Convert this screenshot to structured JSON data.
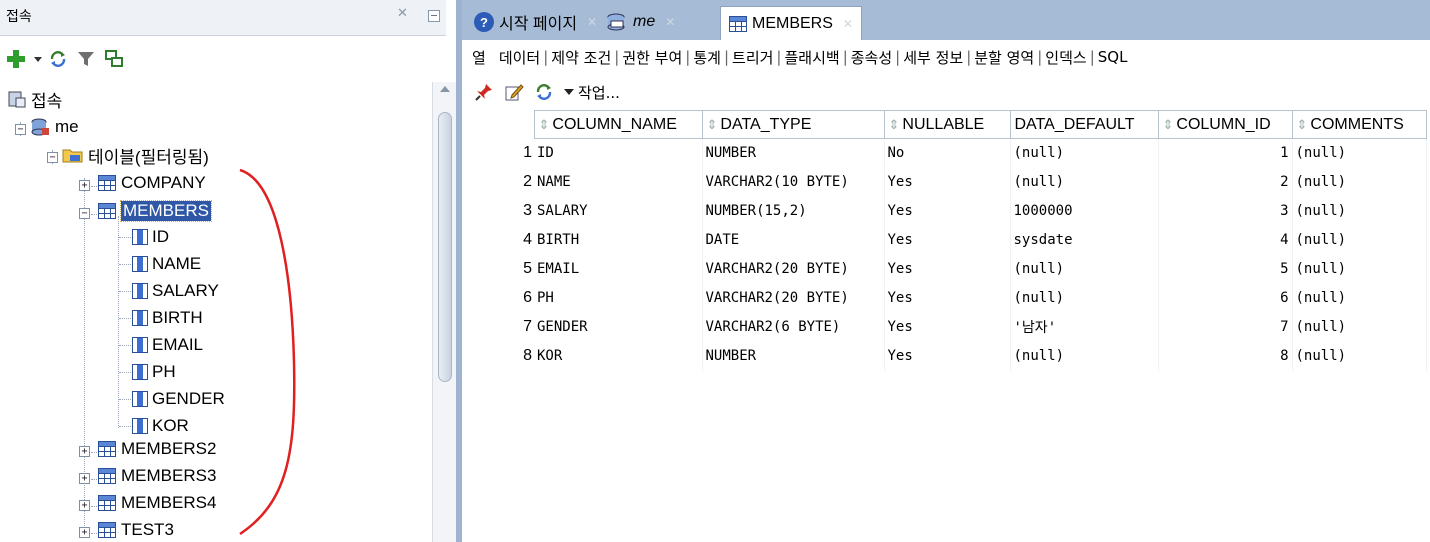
{
  "connections_panel": {
    "title": "접속",
    "root_label": "접속",
    "connection_name": "me",
    "tables_folder_label": "테이블(필터링됨)",
    "tables": [
      "COMPANY",
      "MEMBERS",
      "MEMBERS2",
      "MEMBERS3",
      "MEMBERS4",
      "TEST3"
    ],
    "selected_table": "MEMBERS",
    "members_columns": [
      "ID",
      "NAME",
      "SALARY",
      "BIRTH",
      "EMAIL",
      "PH",
      "GENDER",
      "KOR"
    ],
    "toolbar_icons": [
      "add-icon",
      "dropdown-icon",
      "refresh-icon",
      "filter-icon",
      "schema-browser-icon"
    ]
  },
  "editor": {
    "tabs": [
      {
        "label": "시작 페이지",
        "icon": "help-icon"
      },
      {
        "label": "me",
        "icon": "sql-connection-icon"
      },
      {
        "label": "MEMBERS",
        "icon": "table-icon"
      }
    ],
    "active_tab": "MEMBERS",
    "subtabs": [
      "열",
      "데이터",
      "제약 조건",
      "권한 부여",
      "통계",
      "트리거",
      "플래시백",
      "종속성",
      "세부 정보",
      "분할 영역",
      "인덱스",
      "SQL"
    ],
    "active_subtab": "열",
    "toolbar": {
      "action_label": "작업..."
    },
    "grid": {
      "headers": [
        "COLUMN_NAME",
        "DATA_TYPE",
        "NULLABLE",
        "DATA_DEFAULT",
        "COLUMN_ID",
        "COMMENTS"
      ],
      "rows": [
        {
          "n": "1",
          "name": "ID",
          "type": "NUMBER",
          "nullable": "No",
          "default": "(null)",
          "id": "1",
          "comments": "(null)"
        },
        {
          "n": "2",
          "name": "NAME",
          "type": "VARCHAR2(10 BYTE)",
          "nullable": "Yes",
          "default": "(null)",
          "id": "2",
          "comments": "(null)"
        },
        {
          "n": "3",
          "name": "SALARY",
          "type": "NUMBER(15,2)",
          "nullable": "Yes",
          "default": "1000000",
          "id": "3",
          "comments": "(null)"
        },
        {
          "n": "4",
          "name": "BIRTH",
          "type": "DATE",
          "nullable": "Yes",
          "default": "sysdate",
          "id": "4",
          "comments": "(null)"
        },
        {
          "n": "5",
          "name": "EMAIL",
          "type": "VARCHAR2(20 BYTE)",
          "nullable": "Yes",
          "default": "(null)",
          "id": "5",
          "comments": "(null)"
        },
        {
          "n": "6",
          "name": "PH",
          "type": "VARCHAR2(20 BYTE)",
          "nullable": "Yes",
          "default": "(null)",
          "id": "6",
          "comments": "(null)"
        },
        {
          "n": "7",
          "name": "GENDER",
          "type": "VARCHAR2(6 BYTE)",
          "nullable": "Yes",
          "default": "'남자'",
          "id": "7",
          "comments": "(null)"
        },
        {
          "n": "8",
          "name": "KOR",
          "type": "NUMBER",
          "nullable": "Yes",
          "default": "(null)",
          "id": "8",
          "comments": "(null)"
        }
      ]
    }
  },
  "colors": {
    "selection": "#2f57a6",
    "tab_bar": "#a6bbd6",
    "annotation": "#e02020"
  }
}
